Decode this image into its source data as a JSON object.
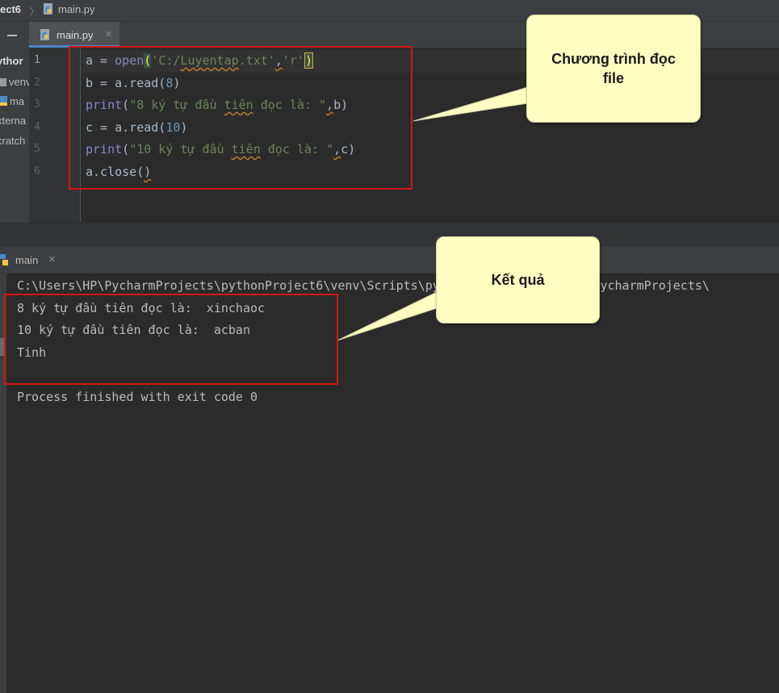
{
  "breadcrumb": {
    "project": "ect6",
    "file": "main.py"
  },
  "sidebar": {
    "items": [
      {
        "label": "ythor"
      },
      {
        "label": "venv"
      },
      {
        "label": "ma"
      },
      {
        "label": "xterna"
      },
      {
        "label": "cratch"
      }
    ]
  },
  "editor": {
    "tab": {
      "label": "main.py",
      "close": "×"
    },
    "line_numbers": [
      "1",
      "2",
      "3",
      "4",
      "5",
      "6"
    ],
    "code": {
      "l1": {
        "a": "a = ",
        "open": "open",
        "p1": "(",
        "s1": "'C:/",
        "s1u": "Luyentap",
        "s1b": ".txt'",
        "c": ",",
        "s2": "'r'",
        "p2": ")"
      },
      "l2": {
        "a": "b = a.read(",
        "n": "8",
        "b": ")"
      },
      "l3": {
        "fn": "print",
        "p": "(",
        "s1": "\"8 ký tự đầu ",
        "u": "tiên",
        "s2": " đọc là: \"",
        "c": ",",
        "b": "b)"
      },
      "l4": {
        "a": "c = a.read(",
        "n": "10",
        "b": ")"
      },
      "l5": {
        "fn": "print",
        "p": "(",
        "s1": "\"10 ký tự đầu ",
        "u": "tiên",
        "s2": " đọc là: \"",
        "c": ",",
        "b": "c)"
      },
      "l6": {
        "a": "a.close(",
        "b": ")"
      }
    }
  },
  "run": {
    "tab_label": "main",
    "tab_close": "×",
    "output": [
      "C:\\Users\\HP\\PycharmProjects\\pythonProject6\\venv\\Scripts\\python.exe C:/Users\\HP\\PycharmProjects\\",
      "8 ký tự đầu tiên đọc là:  xinchaoc",
      "10 ký tự đầu tiên đọc là:  acban",
      "Tinh",
      "",
      "Process finished with exit code 0"
    ]
  },
  "annotations": {
    "code_callout": "Chương trình đọc file",
    "result_callout": "Kết quả"
  },
  "colors": {
    "annotation_border": "#d41515",
    "callout_bg": "#fffec2",
    "string": "#6a8759",
    "builtin": "#8888c6",
    "number": "#6897bb"
  },
  "icons": {
    "python_file": "python-file-icon",
    "folder": "folder-icon",
    "minimize": "minimize-icon"
  }
}
